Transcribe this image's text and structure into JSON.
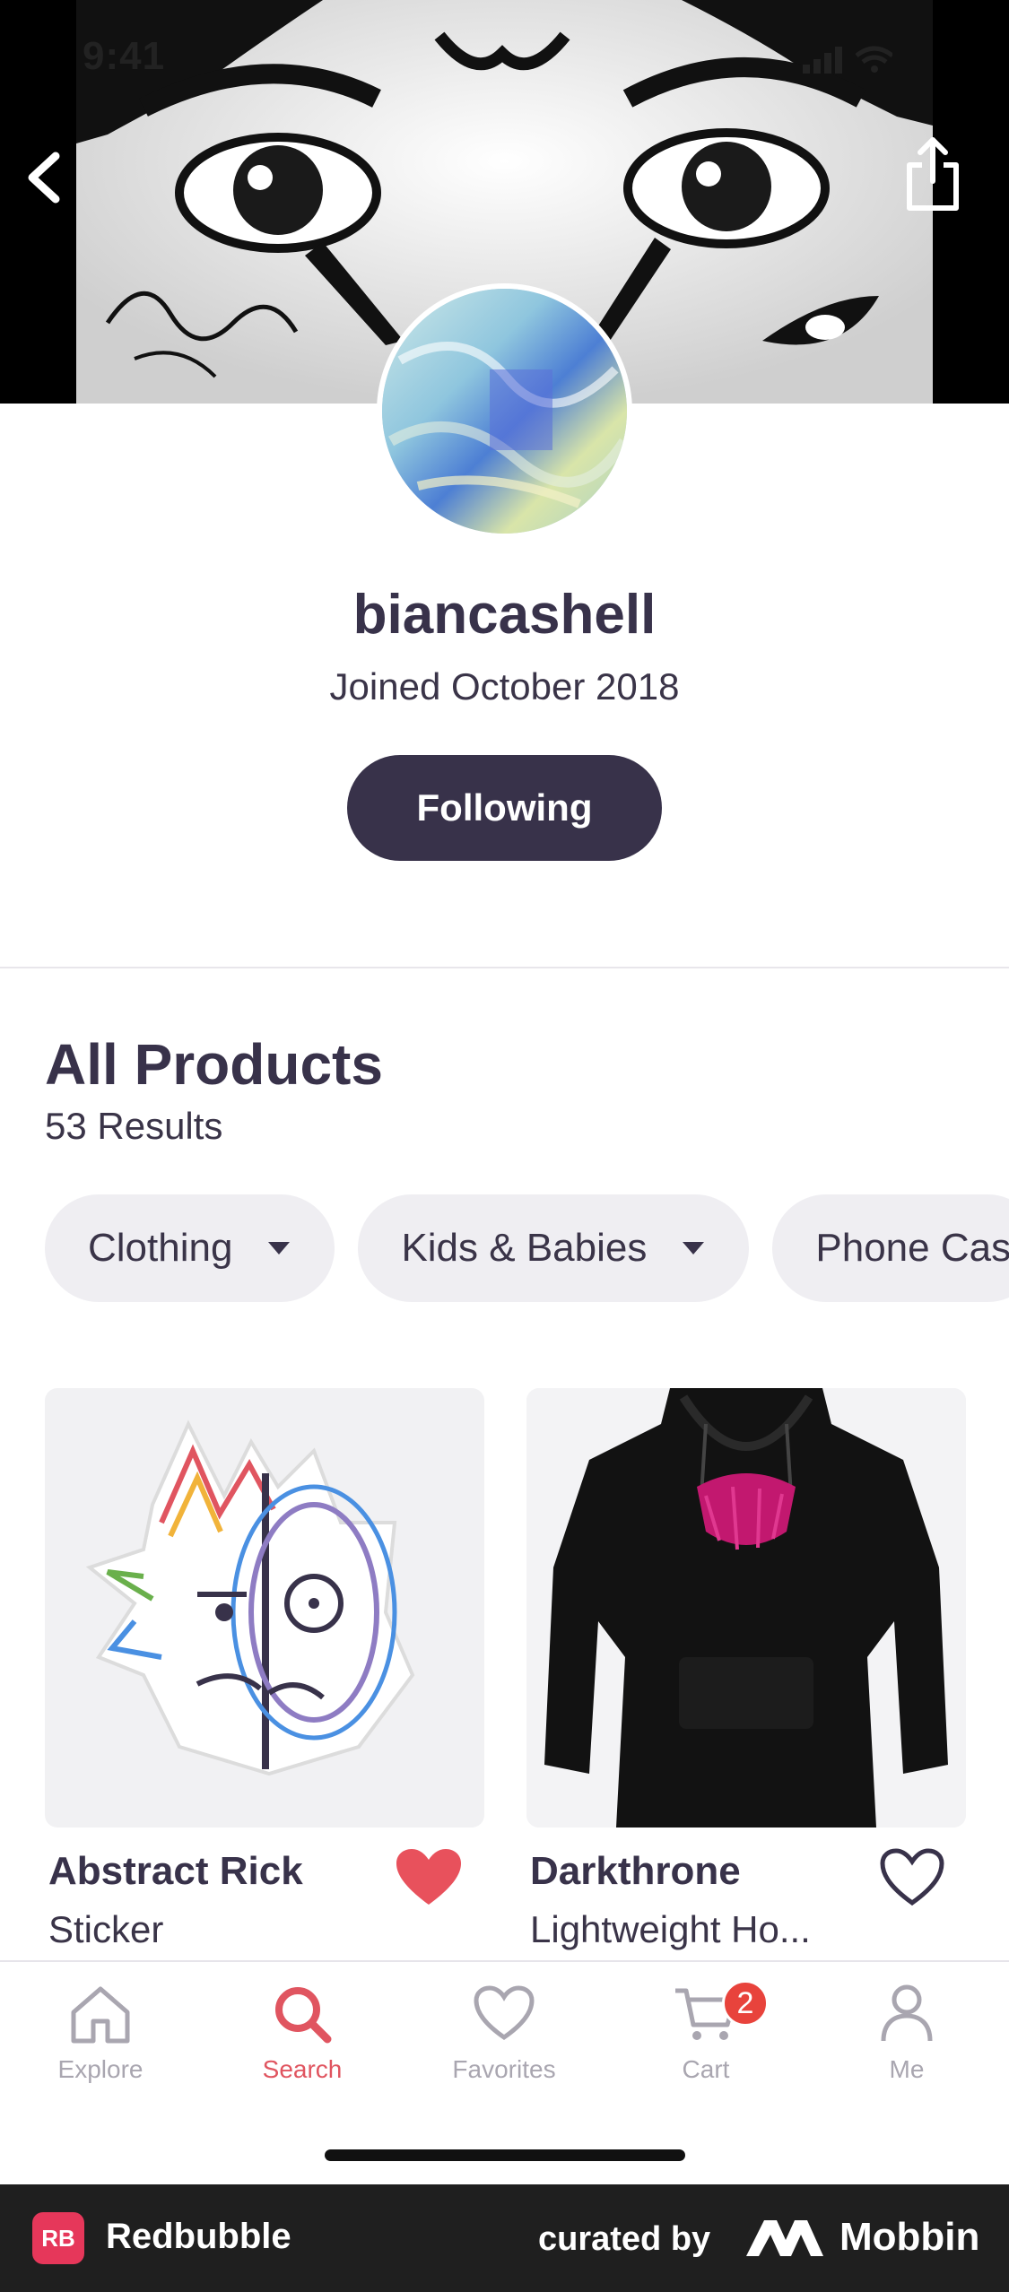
{
  "status_bar": {
    "time": "9:41"
  },
  "profile": {
    "username": "biancashell",
    "joined": "Joined October 2018",
    "follow_label": "Following"
  },
  "products_section": {
    "title": "All Products",
    "results": "53 Results",
    "filters": [
      {
        "label": "Clothing"
      },
      {
        "label": "Kids & Babies"
      },
      {
        "label": "Phone Cases"
      }
    ],
    "items": [
      {
        "title": "Abstract Rick",
        "subtitle": "Sticker",
        "favorited": true
      },
      {
        "title": "Darkthrone",
        "subtitle": "Lightweight Ho...",
        "favorited": false
      }
    ]
  },
  "tabbar": {
    "tabs": [
      {
        "label": "Explore",
        "icon": "home-icon"
      },
      {
        "label": "Search",
        "icon": "search-icon",
        "active": true
      },
      {
        "label": "Favorites",
        "icon": "heart-icon"
      },
      {
        "label": "Cart",
        "icon": "cart-icon",
        "badge": "2"
      },
      {
        "label": "Me",
        "icon": "person-icon"
      }
    ]
  },
  "footer": {
    "brand": "Redbubble",
    "curated_by": "curated by",
    "partner": "Mobbin"
  },
  "colors": {
    "primary": "#38324a",
    "accent": "#e05560",
    "badge": "#e8433c",
    "chip_bg": "#efeef2",
    "footer_bg": "#1f1f1f",
    "brand_red": "#e6375a"
  }
}
